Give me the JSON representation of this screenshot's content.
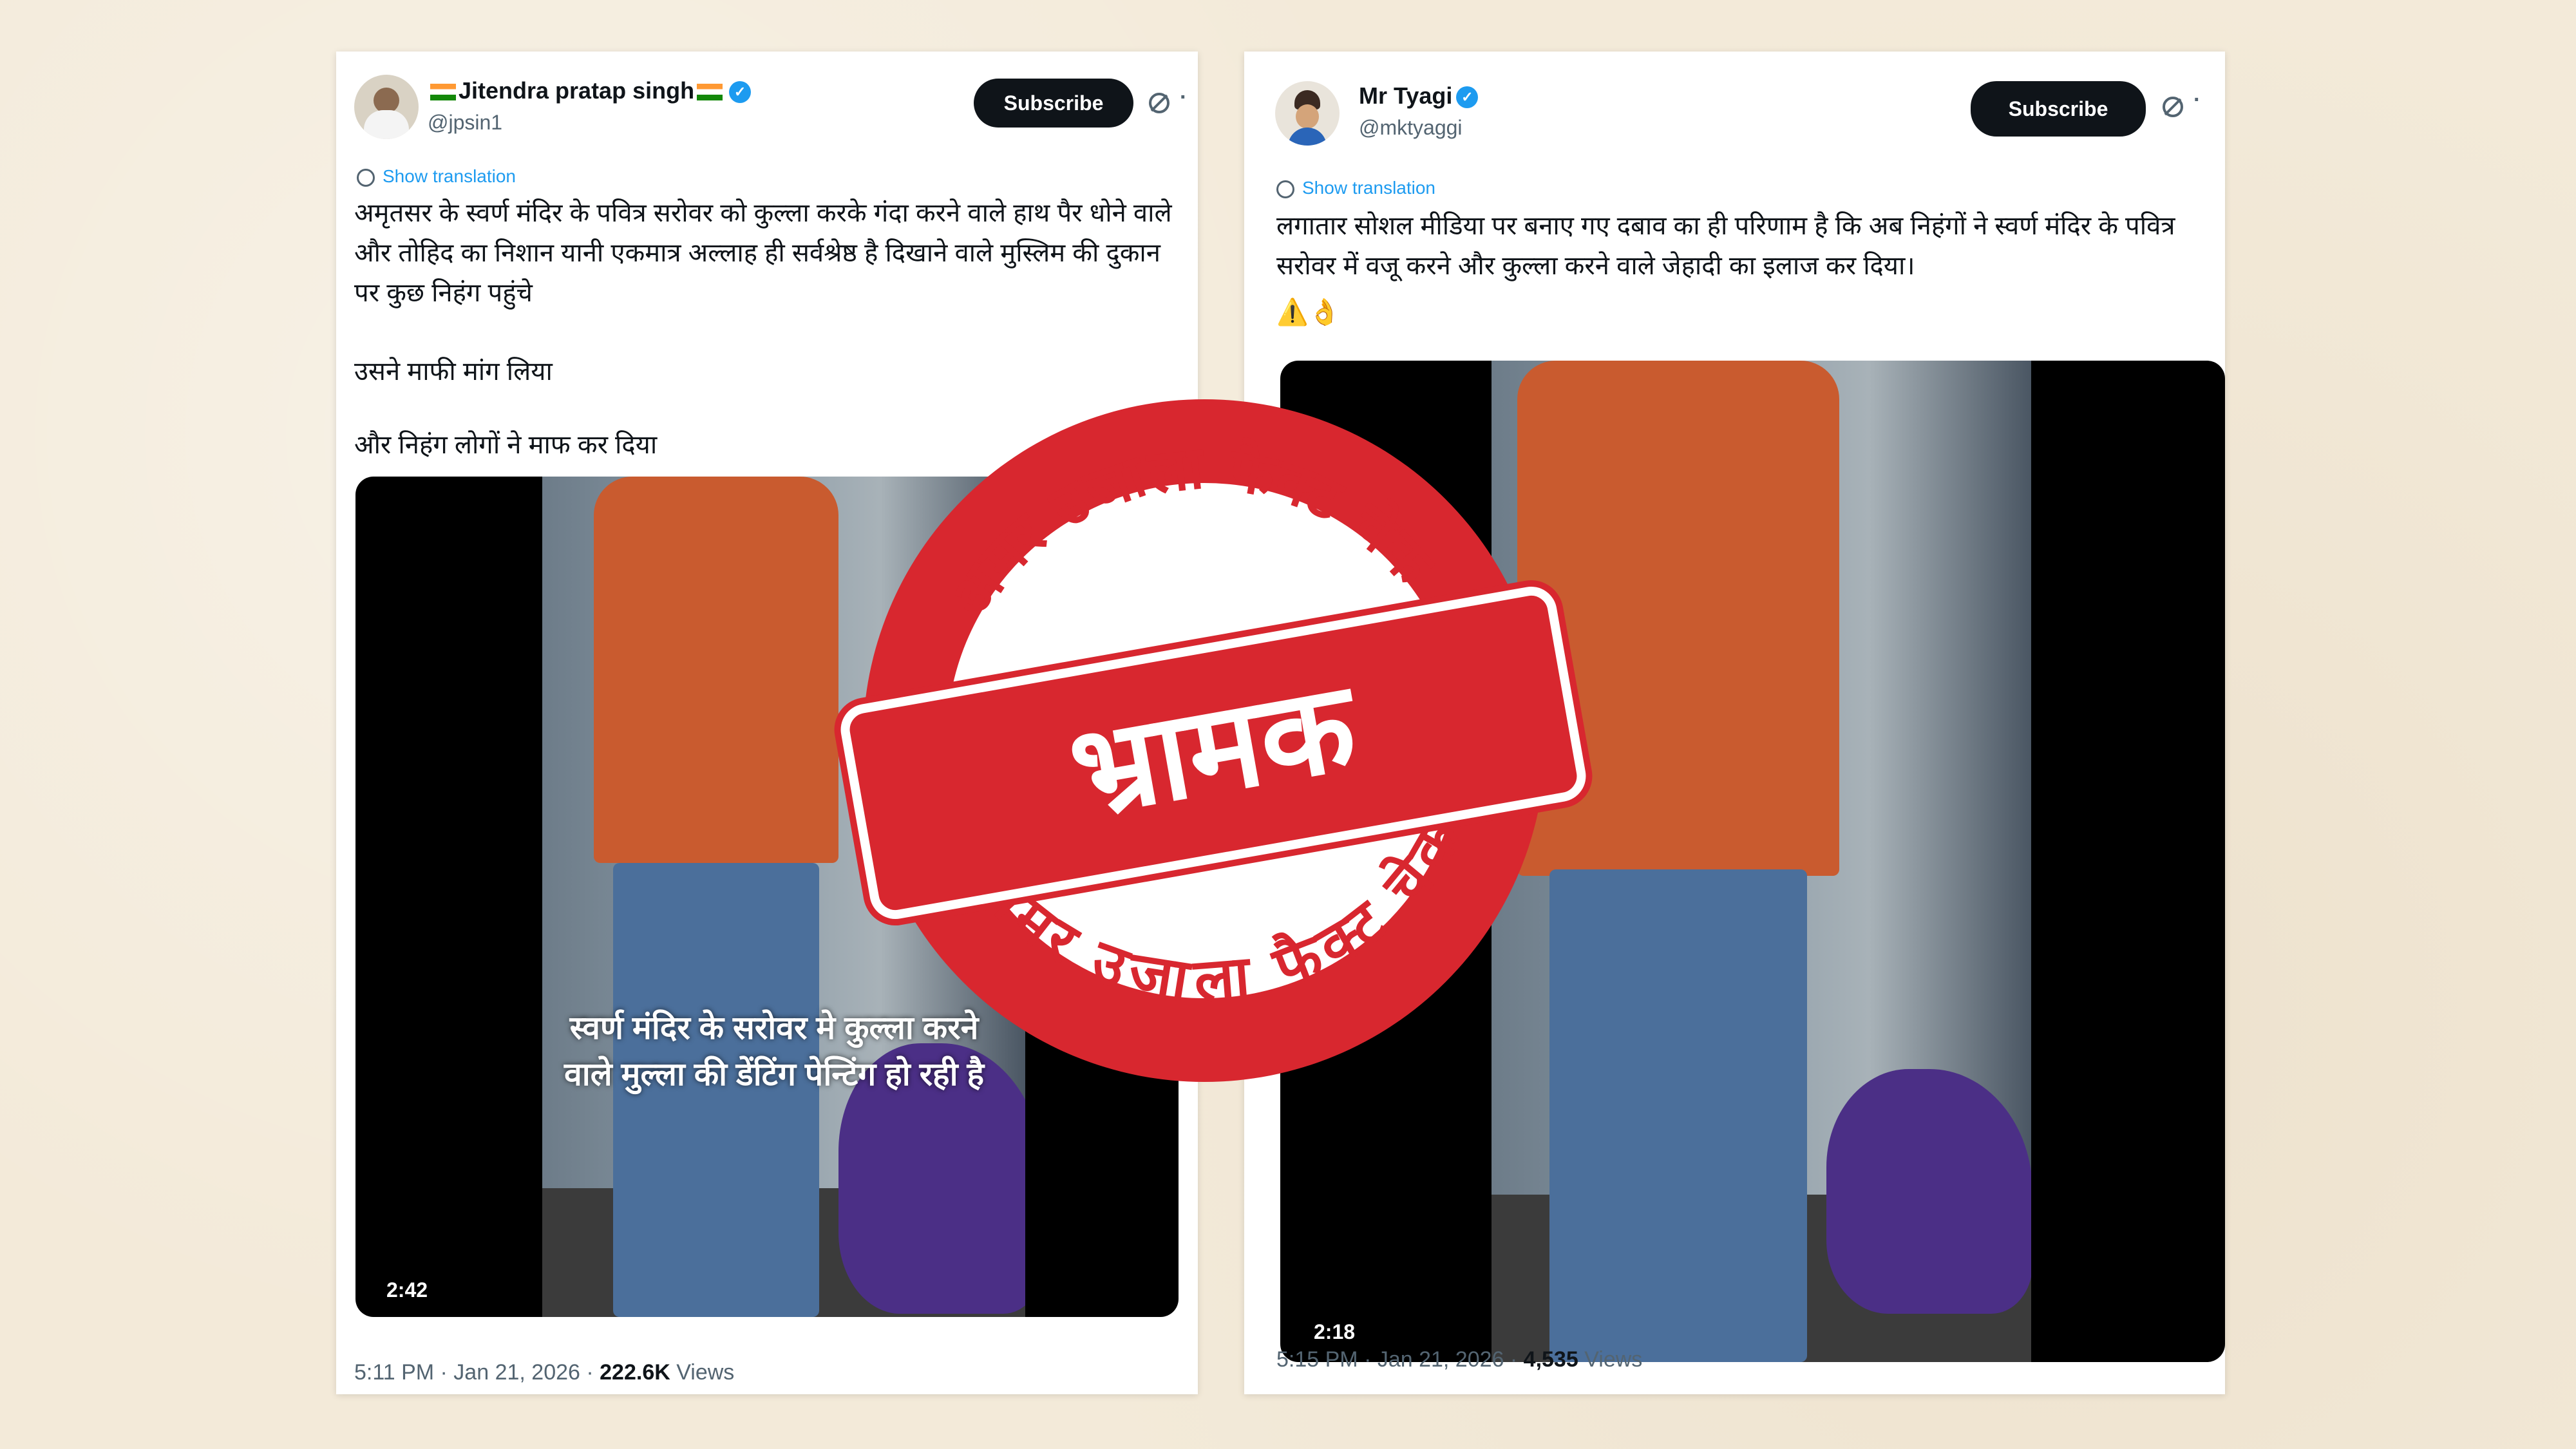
{
  "tweet1": {
    "name": "Jitendra pratap singh",
    "handle": "@jpsin1",
    "subscribe_label": "Subscribe",
    "show_translation": "Show translation",
    "paragraphs": [
      "अमृतसर के स्वर्ण मंदिर के पवित्र सरोवर को कुल्ला करके गंदा करने वाले हाथ पैर धोने वाले और तोहिद का निशान यानी एकमात्र अल्लाह ही सर्वश्रेष्ठ है दिखाने वाले मुस्लिम की दुकान पर कुछ निहंग पहुंचे",
      "उसने माफी मांग लिया",
      "और निहंग लोगों ने माफ कर दिया"
    ],
    "video_overlay": "स्वर्ण मंदिर के सरोवर मे कुल्ला करने वाले मुल्ला की डेंटिंग पेन्टिंग हो रही है",
    "duration": "2:42",
    "time": "5:11 PM · Jan 21, 2026 · ",
    "views_count": "222.6K",
    "views_label": " Views"
  },
  "tweet2": {
    "name": "Mr Tyagi",
    "handle": "@mktyaggi",
    "subscribe_label": "Subscribe",
    "show_translation": "Show translation",
    "text": "लगातार सोशल मीडिया पर बनाए गए दबाव का ही परिणाम है कि अब निहंगों ने स्वर्ण मंदिर के पवित्र सरोवर में वजू करने और कुल्ला करने वाले जेहादी का इलाज कर दिया।",
    "emoji": "⚠️👌",
    "duration": "2:18",
    "time": "5:15 PM · Jan 21, 2026 · ",
    "views_count": "4,535",
    "views_label": " Views"
  },
  "stamp": {
    "verdict": "भ्रामक",
    "ring_text": "अमर उजाला फैक्ट चेक"
  },
  "colors": {
    "stamp_red": "#d8272f",
    "background": "#f3ead9",
    "link_blue": "#1d9bf0"
  }
}
